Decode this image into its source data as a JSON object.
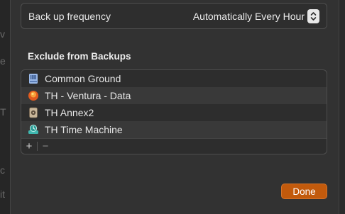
{
  "backup": {
    "frequency_label": "Back up frequency",
    "frequency_value": "Automatically Every Hour"
  },
  "exclude": {
    "title": "Exclude from Backups",
    "items": [
      {
        "label": "Common Ground",
        "icon": "drive-icon"
      },
      {
        "label": "TH - Ventura - Data",
        "icon": "volume-ball-icon"
      },
      {
        "label": "TH Annex2",
        "icon": "external-disk-icon"
      },
      {
        "label": "TH Time Machine",
        "icon": "time-machine-disk-icon"
      }
    ],
    "add_label": "+",
    "remove_label": "−"
  },
  "actions": {
    "done_label": "Done"
  },
  "background": {
    "letters": [
      "v",
      "e",
      "T",
      "c",
      "it"
    ]
  },
  "colors": {
    "accent": "#c25a0c",
    "sheet_bg": "#323232"
  }
}
